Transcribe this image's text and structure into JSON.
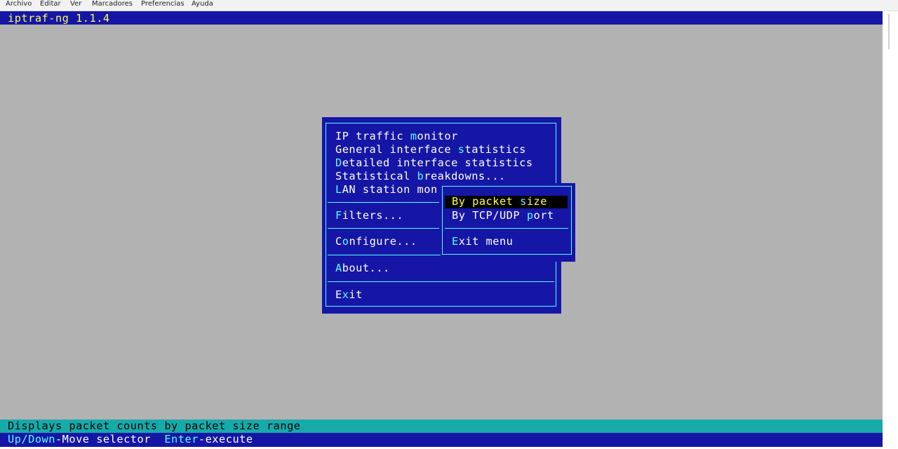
{
  "menubar": {
    "items": [
      "Archivo",
      "Editar",
      "Ver",
      "Marcadores",
      "Preferencias",
      "Ayuda"
    ]
  },
  "terminal": {
    "title": "iptraf-ng 1.1.4"
  },
  "main_menu": {
    "items": [
      {
        "pre": "IP traffic ",
        "hk": "m",
        "post": "onitor"
      },
      {
        "pre": "General interface ",
        "hk": "s",
        "post": "tatistics"
      },
      {
        "pre": "",
        "hk": "D",
        "post": "etailed interface statistics"
      },
      {
        "pre": "Statistical ",
        "hk": "b",
        "post": "reakdowns..."
      },
      {
        "pre": "",
        "hk": "L",
        "post": "AN station mon"
      },
      {
        "pre": "",
        "hk": "F",
        "post": "ilters..."
      },
      {
        "pre": "C",
        "hk": "o",
        "post": "nfigure..."
      },
      {
        "pre": "",
        "hk": "A",
        "post": "bout..."
      },
      {
        "pre": "E",
        "hk": "x",
        "post": "it"
      }
    ]
  },
  "submenu": {
    "selected": {
      "pre": "By packet ",
      "hk": "s",
      "post": "ize"
    },
    "items": [
      {
        "pre": "By TCP/UDP ",
        "hk": "p",
        "post": "ort"
      },
      {
        "pre": "",
        "hk": "E",
        "post": "xit menu"
      }
    ]
  },
  "status": {
    "description": "Displays packet counts by packet size range",
    "keys": [
      {
        "key": "Up/Down",
        "desc": "-Move selector  "
      },
      {
        "key": "Enter",
        "desc": "-execute"
      }
    ]
  },
  "colors": {
    "terminal_bg": "#b2b2b2",
    "window_bg": "#1616a6",
    "hotkey": "#55ffff",
    "title_text": "#ffff55",
    "status_bg": "#16aaaa"
  }
}
